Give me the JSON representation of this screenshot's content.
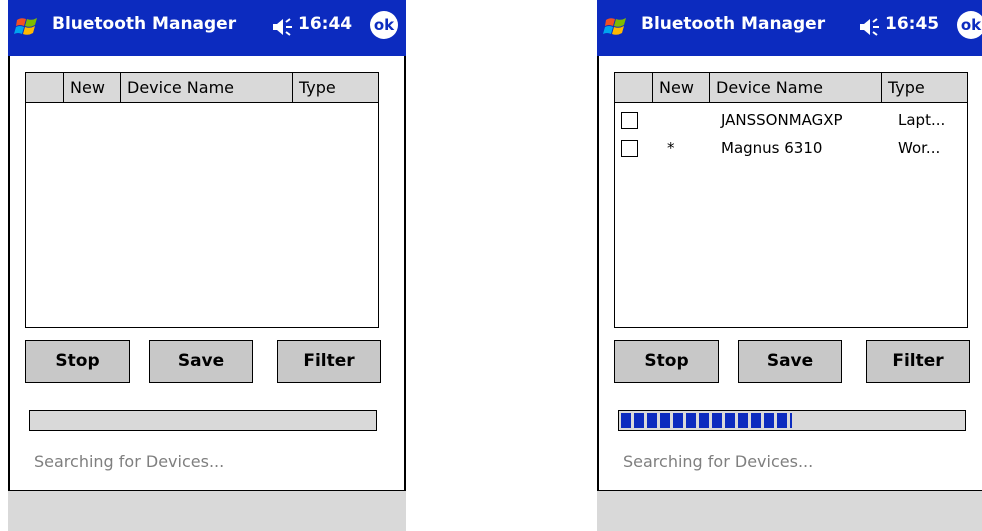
{
  "left": {
    "title": "Bluetooth Manager",
    "time": "16:44",
    "ok_label": "ok",
    "columns": [
      "",
      "New",
      "Device Name",
      "Type"
    ],
    "devices": [],
    "buttons": {
      "stop": "Stop",
      "save": "Save",
      "filter": "Filter"
    },
    "progress": 0,
    "status": "Searching for Devices..."
  },
  "right": {
    "title": "Bluetooth Manager",
    "time": "16:45",
    "ok_label": "ok",
    "columns": [
      "",
      "New",
      "Device Name",
      "Type"
    ],
    "devices": [
      {
        "new": "",
        "name": "JANSSONMAGXP",
        "type": "Lapt..."
      },
      {
        "new": "*",
        "name": "Magnus 6310",
        "type": "Wor..."
      }
    ],
    "buttons": {
      "stop": "Stop",
      "save": "Save",
      "filter": "Filter"
    },
    "progress": 0.5,
    "status": "Searching for Devices..."
  },
  "colors": {
    "titlebar": "#0c2bbf",
    "progress": "#0c2bbf",
    "button": "#c8c8c8",
    "status_text": "#7f7f7f"
  },
  "icons": {
    "logo": "windows-flag-icon",
    "volume": "speaker-icon",
    "ok": "ok-button"
  }
}
